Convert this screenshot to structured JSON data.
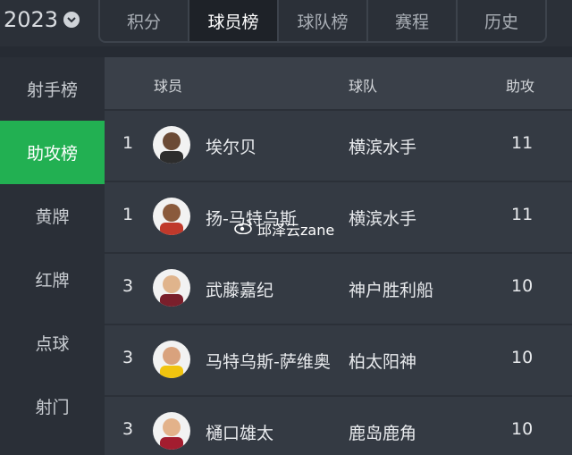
{
  "season": "2023",
  "tabs": [
    {
      "label": "积分",
      "active": false
    },
    {
      "label": "球员榜",
      "active": true
    },
    {
      "label": "球队榜",
      "active": false
    },
    {
      "label": "赛程",
      "active": false
    },
    {
      "label": "历史",
      "active": false
    }
  ],
  "sidebar": {
    "items": [
      {
        "label": "射手榜",
        "active": false
      },
      {
        "label": "助攻榜",
        "active": true
      },
      {
        "label": "黄牌",
        "active": false
      },
      {
        "label": "红牌",
        "active": false
      },
      {
        "label": "点球",
        "active": false
      },
      {
        "label": "射门",
        "active": false
      }
    ]
  },
  "table": {
    "headers": {
      "player": "球员",
      "team": "球队",
      "assists": "助攻"
    },
    "rows": [
      {
        "rank": "1",
        "player": "埃尔贝",
        "team": "横滨水手",
        "assists": "11"
      },
      {
        "rank": "1",
        "player": "扬-马特乌斯",
        "team": "横滨水手",
        "assists": "11"
      },
      {
        "rank": "3",
        "player": "武藤嘉纪",
        "team": "神户胜利船",
        "assists": "10"
      },
      {
        "rank": "3",
        "player": "马特乌斯-萨维奥",
        "team": "柏太阳神",
        "assists": "10"
      },
      {
        "rank": "3",
        "player": "樋口雄太",
        "team": "鹿岛鹿角",
        "assists": "10"
      }
    ]
  },
  "watermark": "邱泽云zane",
  "colors": {
    "accent": "#22b052",
    "background": "#262b33"
  }
}
